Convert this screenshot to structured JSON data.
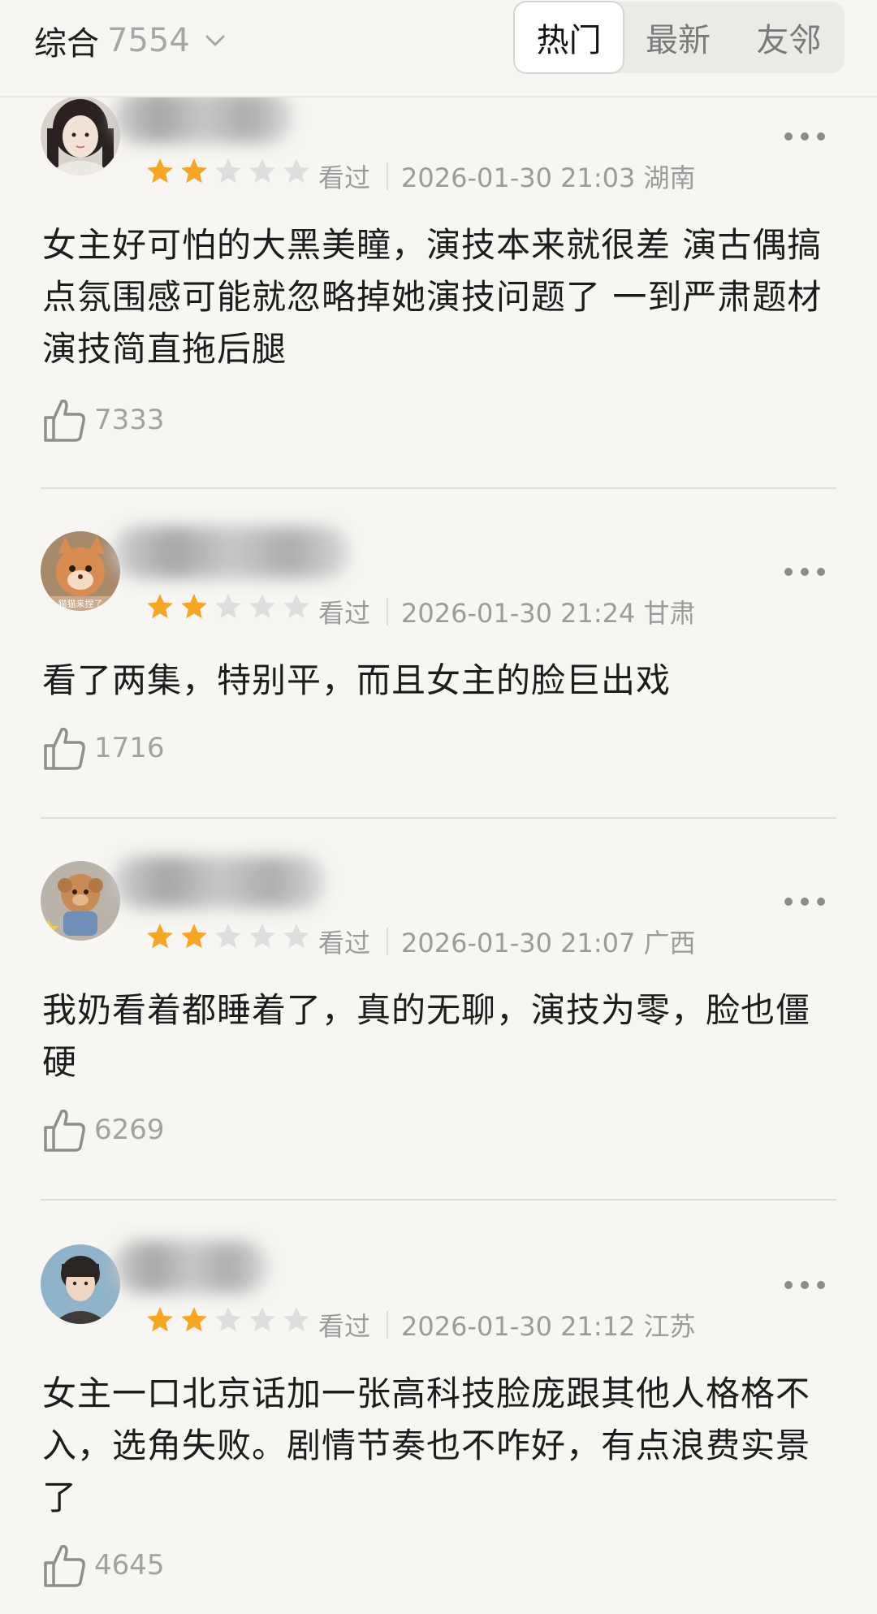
{
  "header": {
    "filter_label": "综合",
    "filter_count": "7554",
    "tabs": [
      {
        "label": "热门",
        "active": true
      },
      {
        "label": "最新",
        "active": false
      },
      {
        "label": "友邻",
        "active": false
      }
    ]
  },
  "colors": {
    "star_filled": "#f6a623",
    "star_empty": "#dedede",
    "background": "#f7f6f3"
  },
  "comments": [
    {
      "rating": 2,
      "status": "看过",
      "time_location": "2026-01-30 21:03 湖南",
      "text": "女主好可怕的大黑美瞳，演技本来就很差 演古偶搞点氛围感可能就忽略掉她演技问题了 一到严肃题材演技简直拖后腿",
      "likes": "7333"
    },
    {
      "rating": 2,
      "status": "看过",
      "time_location": "2026-01-30 21:24 甘肃",
      "text": "看了两集，特别平，而且女主的脸巨出戏",
      "likes": "1716",
      "avatar_caption": "猫猫来捏了"
    },
    {
      "rating": 2,
      "status": "看过",
      "time_location": "2026-01-30 21:07 广西",
      "text": "我奶看着都睡着了，真的无聊，演技为零，脸也僵硬",
      "likes": "6269"
    },
    {
      "rating": 2,
      "status": "看过",
      "time_location": "2026-01-30 21:12 江苏",
      "text": "女主一口北京话加一张高科技脸庞跟其他人格格不入，选角失败。剧情节奏也不咋好，有点浪费实景了",
      "likes": "4645"
    }
  ]
}
